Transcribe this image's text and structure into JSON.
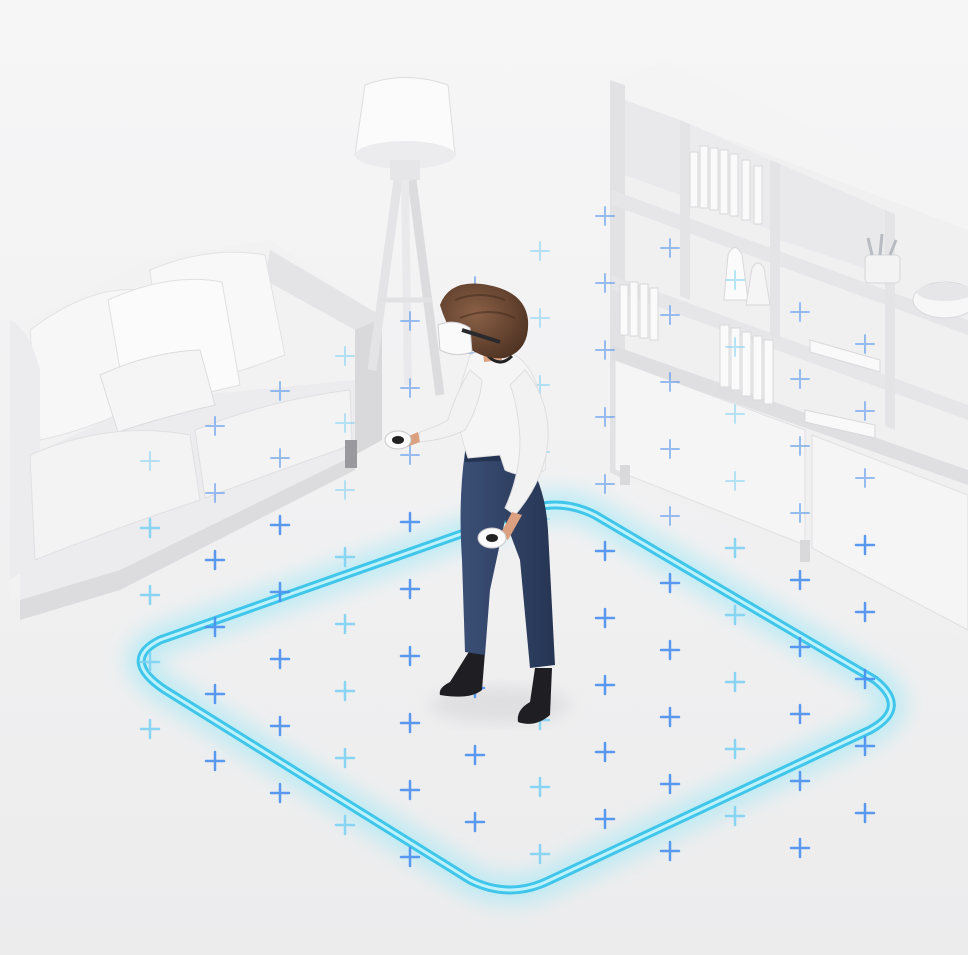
{
  "scene": {
    "subject": "person-with-vr-headset",
    "colors": {
      "background": "#f4f4f5",
      "floor": "#eeeeef",
      "furniture": "#f7f7f8",
      "furniture_shade": "#dedee0",
      "boundary_outer": "#9ae8f7",
      "boundary_core": "#3fc6ea",
      "boundary_edge": "#4e8fe8",
      "marker": "#4a8ff0",
      "marker_light": "#7fd2f4",
      "hair": "#6e4a33",
      "shirt": "#f5f5f5",
      "jeans": "#2f4164",
      "shoes": "#1f1f23",
      "skin": "#dba07f"
    },
    "icons": [
      "floor-lamp-icon",
      "sofa-icon",
      "bookshelf-icon",
      "vr-headset-icon",
      "controller-icon"
    ]
  }
}
